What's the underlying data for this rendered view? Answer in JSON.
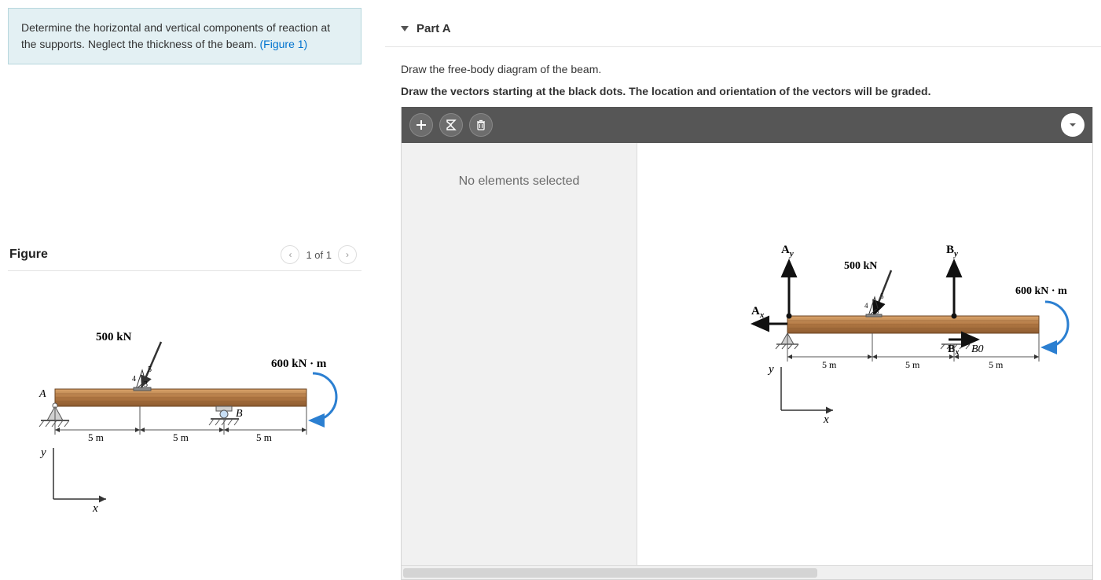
{
  "problem": {
    "text_pre": "Determine the horizontal and vertical components of reaction at the supports. Neglect the thickness of the beam. ",
    "figure_link": "(Figure 1)"
  },
  "figure": {
    "title": "Figure",
    "nav_text": "1 of 1"
  },
  "figure_labels": {
    "force": "500 kN",
    "moment": "600 kN · m",
    "ratio_top": "5",
    "ratio_bottom": "3",
    "ratio_side": "4",
    "dim": "5 m",
    "pointA": "A",
    "pointB": "B",
    "x": "x",
    "y": "y"
  },
  "part": {
    "title": "Part A",
    "instr1": "Draw the free-body diagram of the beam.",
    "instr2": "Draw the vectors starting at the black dots. The location and orientation of the vectors will be graded."
  },
  "canvas": {
    "side_msg": "No elements selected",
    "labels": {
      "Ay": "A",
      "Ay_sub": "y",
      "Ax": "A",
      "Ax_sub": "x",
      "By": "B",
      "By_sub": "y",
      "Bx": "B",
      "Bx_sub": "x",
      "B0": "B0"
    }
  }
}
